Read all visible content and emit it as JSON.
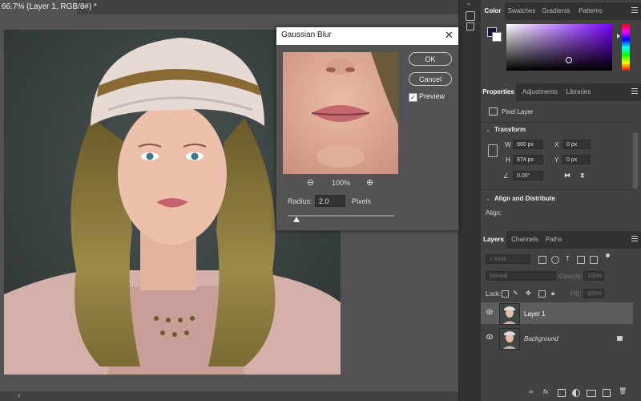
{
  "document": {
    "tab_title": "66.7% (Layer 1, RGB/8#) *",
    "tab_close": "×",
    "status_arrow": "›"
  },
  "dialog": {
    "title": "Gaussian Blur",
    "close_glyph": "✕",
    "ok_label": "OK",
    "cancel_label": "Cancel",
    "preview_label": "Preview",
    "preview_checked": true,
    "zoom_level": "100%",
    "radius_label": "Radius:",
    "radius_value": "2.0",
    "radius_unit": "Pixels",
    "radius_slider_fraction": 0.08
  },
  "color_panel": {
    "tabs": [
      "Color",
      "Swatches",
      "Gradients",
      "Patterns"
    ],
    "foreground": "#1d0f3a",
    "background": "#ffffff",
    "hue_color": "#7a00ff"
  },
  "properties_panel": {
    "tabs": [
      "Properties",
      "Adjustments",
      "Libraries"
    ],
    "layer_type": "Pixel Layer",
    "transform_header": "Transform",
    "w_label": "W",
    "w_value": "900 px",
    "h_label": "H",
    "h_value": "874 px",
    "x_label": "X",
    "x_value": "0 px",
    "y_label": "Y",
    "y_value": "0 px",
    "angle_value": "0.00°",
    "align_header": "Align and Distribute",
    "align_label": "Align:"
  },
  "layers_panel": {
    "tabs": [
      "Layers",
      "Channels",
      "Paths"
    ],
    "filter_placeholder": "Kind",
    "blend_mode": "Normal",
    "opacity_label": "Opacity:",
    "opacity_value": "100%",
    "lock_label": "Lock:",
    "fill_label": "Fill:",
    "fill_value": "100%",
    "layers": [
      {
        "name": "Layer 1",
        "selected": true
      },
      {
        "name": "Background",
        "selected": false,
        "locked": true
      }
    ],
    "footer_icons": [
      "link-icon",
      "fx-icon",
      "mask-icon",
      "adjustment-icon",
      "group-icon",
      "new-layer-icon",
      "trash-icon"
    ]
  }
}
